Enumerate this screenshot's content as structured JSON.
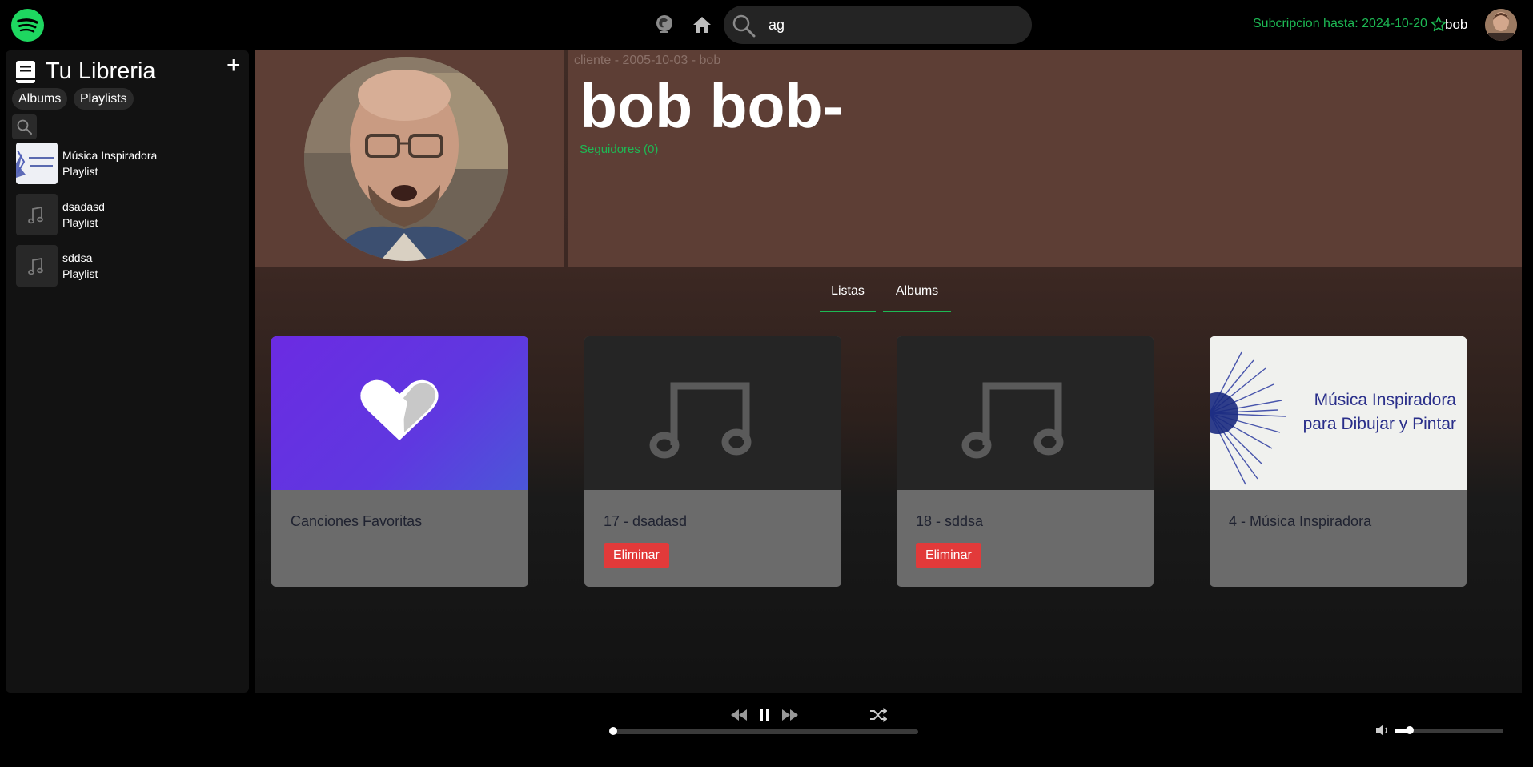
{
  "header": {
    "search_value": "ag",
    "subscription_text": "Subcripcion hasta: 2024-10-20",
    "username": "bob"
  },
  "library": {
    "title": "Tu Libreria",
    "filters": [
      "Albums",
      "Playlists"
    ],
    "items": [
      {
        "name": "Música Inspiradora",
        "type": "Playlist",
        "thumb": "image"
      },
      {
        "name": "dsadasd",
        "type": "Playlist",
        "thumb": "music-note-icon"
      },
      {
        "name": "sddsa",
        "type": "Playlist",
        "thumb": "music-note-icon"
      }
    ]
  },
  "profile": {
    "meta": "cliente - 2005-10-03 - bob",
    "name": "bob bob-",
    "followers": "Seguidores (0)"
  },
  "tabs": [
    "Listas",
    "Albums"
  ],
  "cards": [
    {
      "title": "Canciones Favoritas",
      "art": "heart-icon",
      "delete_label": ""
    },
    {
      "title": "17 - dsadasd",
      "art": "music-note-icon",
      "delete_label": "Eliminar"
    },
    {
      "title": "18 - sddsa",
      "art": "music-note-icon",
      "delete_label": "Eliminar"
    },
    {
      "title": "4 - Música Inspiradora",
      "art": "image",
      "art_text": [
        "Música Inspiradora",
        "para Dibujar y Pintar"
      ],
      "delete_label": ""
    }
  ],
  "player": {
    "progress": 0.0,
    "volume": 0.13
  },
  "colors": {
    "accent": "#1db954",
    "hero": "#5d3e35",
    "danger": "#e23a3a"
  }
}
